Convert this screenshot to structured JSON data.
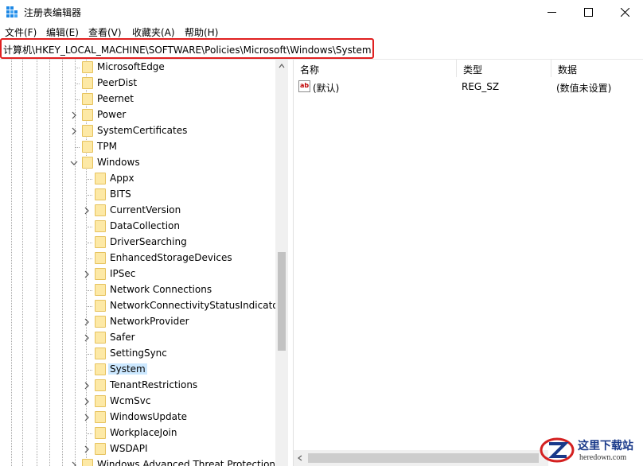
{
  "window": {
    "title": "注册表编辑器"
  },
  "menu": [
    "文件(F)",
    "编辑(E)",
    "查看(V)",
    "收藏夹(A)",
    "帮助(H)"
  ],
  "address": "计算机\\HKEY_LOCAL_MACHINE\\SOFTWARE\\Policies\\Microsoft\\Windows\\System",
  "tree": [
    {
      "label": "MicrosoftEdge",
      "level": 0,
      "expander": "none"
    },
    {
      "label": "PeerDist",
      "level": 0,
      "expander": "none"
    },
    {
      "label": "Peernet",
      "level": 0,
      "expander": "none"
    },
    {
      "label": "Power",
      "level": 0,
      "expander": "collapsed"
    },
    {
      "label": "SystemCertificates",
      "level": 0,
      "expander": "collapsed"
    },
    {
      "label": "TPM",
      "level": 0,
      "expander": "none"
    },
    {
      "label": "Windows",
      "level": 0,
      "expander": "expanded"
    },
    {
      "label": "Appx",
      "level": 1,
      "expander": "none"
    },
    {
      "label": "BITS",
      "level": 1,
      "expander": "none"
    },
    {
      "label": "CurrentVersion",
      "level": 1,
      "expander": "collapsed"
    },
    {
      "label": "DataCollection",
      "level": 1,
      "expander": "none"
    },
    {
      "label": "DriverSearching",
      "level": 1,
      "expander": "none"
    },
    {
      "label": "EnhancedStorageDevices",
      "level": 1,
      "expander": "none"
    },
    {
      "label": "IPSec",
      "level": 1,
      "expander": "collapsed"
    },
    {
      "label": "Network Connections",
      "level": 1,
      "expander": "none"
    },
    {
      "label": "NetworkConnectivityStatusIndicator",
      "level": 1,
      "expander": "none"
    },
    {
      "label": "NetworkProvider",
      "level": 1,
      "expander": "collapsed"
    },
    {
      "label": "Safer",
      "level": 1,
      "expander": "collapsed"
    },
    {
      "label": "SettingSync",
      "level": 1,
      "expander": "none"
    },
    {
      "label": "System",
      "level": 1,
      "expander": "none",
      "selected": true
    },
    {
      "label": "TenantRestrictions",
      "level": 1,
      "expander": "collapsed"
    },
    {
      "label": "WcmSvc",
      "level": 1,
      "expander": "collapsed"
    },
    {
      "label": "WindowsUpdate",
      "level": 1,
      "expander": "collapsed"
    },
    {
      "label": "WorkplaceJoin",
      "level": 1,
      "expander": "none"
    },
    {
      "label": "WSDAPI",
      "level": 1,
      "expander": "collapsed"
    },
    {
      "label": "Windows Advanced Threat Protection",
      "level": 0,
      "expander": "collapsed"
    }
  ],
  "list": {
    "headers": {
      "name": "名称",
      "type": "类型",
      "data": "数据"
    },
    "rows": [
      {
        "icon": "ab",
        "name": "(默认)",
        "type": "REG_SZ",
        "data": "(数值未设置)"
      }
    ]
  },
  "watermark": {
    "title": "这里下载站",
    "url": "heredown.com"
  },
  "colors": {
    "highlight_border": "#e02020",
    "selection": "#cce8ff",
    "folder": "#fde9a6"
  }
}
